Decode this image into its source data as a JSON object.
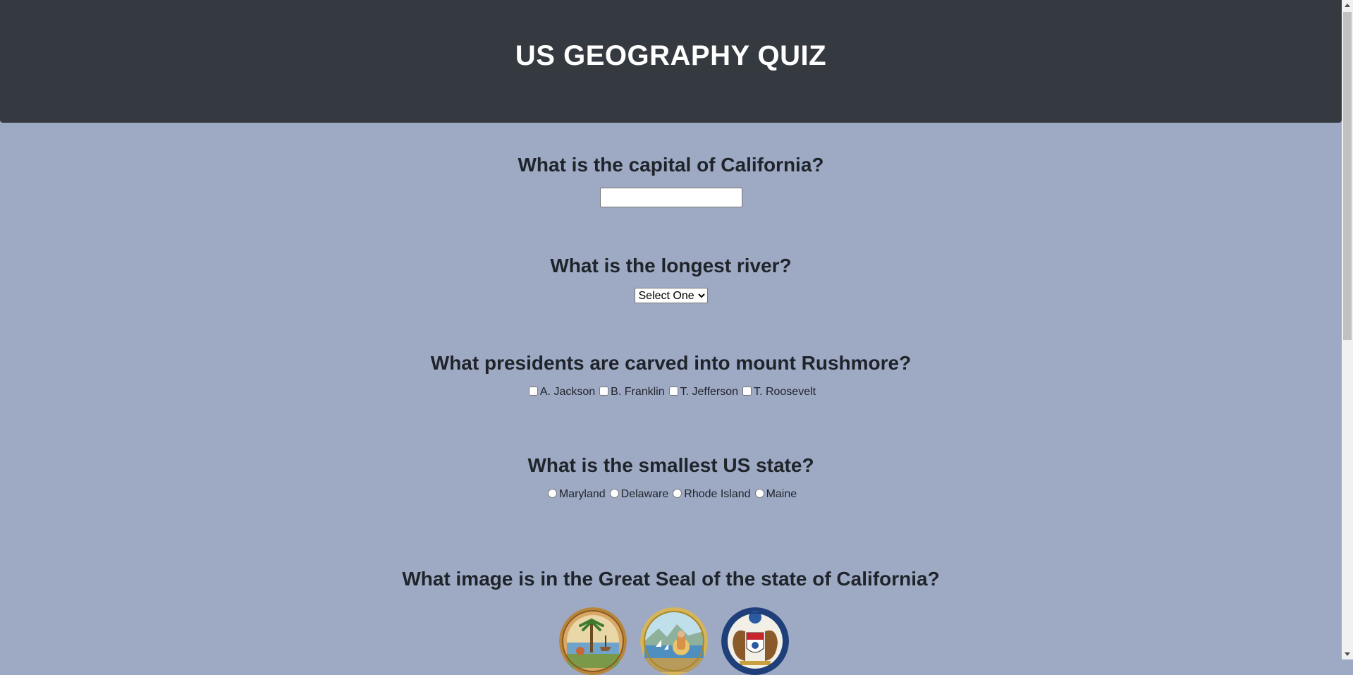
{
  "header": {
    "title": "US GEOGRAPHY QUIZ"
  },
  "questions": {
    "capital": {
      "text": "What is the capital of California?",
      "value": "",
      "placeholder": ""
    },
    "river": {
      "text": "What is the longest river?",
      "selected": "Select One"
    },
    "rushmore": {
      "text": "What presidents are carved into mount Rushmore?",
      "options": [
        "A. Jackson",
        "B. Franklin",
        "T. Jefferson",
        "T. Roosevelt"
      ]
    },
    "smallest": {
      "text": "What is the smallest US state?",
      "options": [
        "Maryland",
        "Delaware",
        "Rhode Island",
        "Maine"
      ]
    },
    "seal": {
      "text": "What image is in the Great Seal of the state of California?",
      "images": [
        "florida-seal",
        "california-seal",
        "missouri-seal"
      ]
    }
  },
  "colors": {
    "header_bg": "#353a41",
    "page_bg": "#9eaac4",
    "text": "#1f232a"
  }
}
